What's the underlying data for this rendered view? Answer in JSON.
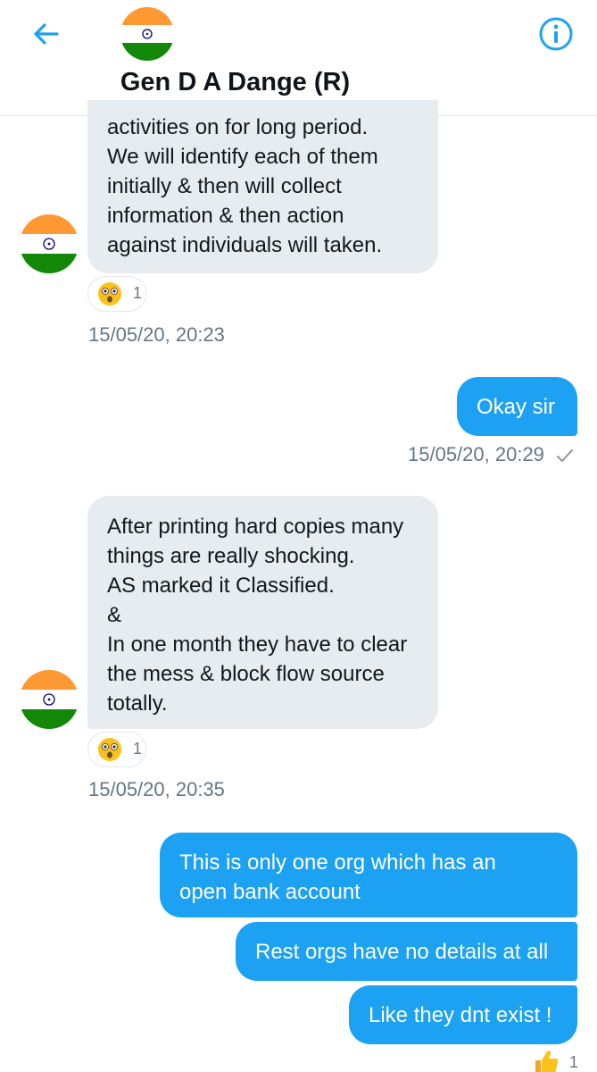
{
  "header": {
    "contact_name": "Gen D A Dange (R)",
    "back_icon": "arrow-left-icon",
    "info_icon": "info-icon"
  },
  "colors": {
    "accent": "#1da1f2",
    "bubble_in": "#e6ecf0",
    "saffron": "#ff9933",
    "green": "#138808",
    "chakra": "#000080"
  },
  "messages": [
    {
      "direction": "in",
      "text": "activities on for long period.\nWe will identify each of them\ninitially & then will collect\ninformation & then action\nagainst individuals will taken.",
      "reaction_count": "1",
      "timestamp": "15/05/20, 20:23"
    },
    {
      "direction": "out",
      "text": "Okay sir",
      "timestamp": "15/05/20, 20:29"
    },
    {
      "direction": "in",
      "text": "After printing hard copies many\nthings are really shocking.\nAS marked it Classified.\n&\nIn one month they have to clear\nthe mess & block flow source\ntotally.",
      "reaction_count": "1",
      "timestamp": "15/05/20, 20:35"
    },
    {
      "direction": "out",
      "text": "This is only one org which has an\nopen bank account"
    },
    {
      "direction": "out",
      "text": "Rest orgs have no details at all"
    },
    {
      "direction": "out",
      "text": "Like they dnt exist !",
      "reaction_count": "1"
    }
  ]
}
